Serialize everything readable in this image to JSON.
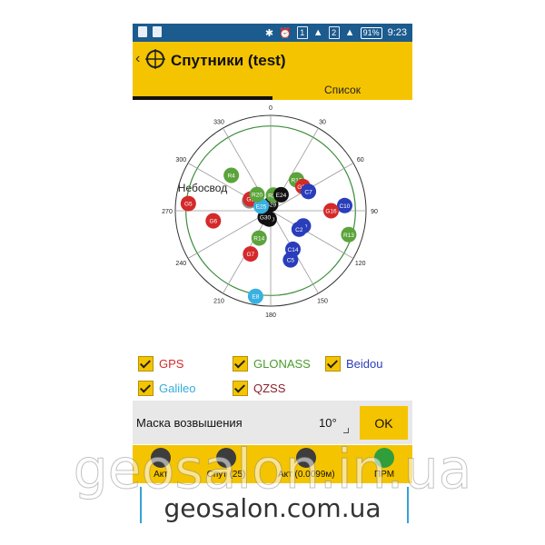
{
  "status_bar": {
    "battery": "91%",
    "time": "9:23",
    "sim1": "1",
    "sim2": "2"
  },
  "app_bar": {
    "title": "Спутники (test)"
  },
  "tabs": [
    {
      "label": "Небосвод",
      "active": true
    },
    {
      "label": "Список",
      "active": false
    }
  ],
  "sky_plot": {
    "azimuth_labels": [
      "0",
      "30",
      "60",
      "90",
      "120",
      "150",
      "180",
      "210",
      "240",
      "270",
      "300",
      "330"
    ],
    "elevation_mask_deg": 10,
    "satellites": [
      {
        "id": "G29",
        "system": "GPS",
        "az": 0,
        "el": 84
      },
      {
        "id": "R21",
        "system": "GLONASS",
        "az": 10,
        "el": 75
      },
      {
        "id": "E24",
        "system": "Galileo",
        "az": 33,
        "el": 72
      },
      {
        "id": "R12",
        "system": "GLONASS",
        "az": 40,
        "el": 52
      },
      {
        "id": "G26",
        "system": "GPS",
        "az": 53,
        "el": 52
      },
      {
        "id": "C7",
        "system": "Beidou",
        "az": 63,
        "el": 50
      },
      {
        "id": "C10",
        "system": "Beidou",
        "az": 86,
        "el": 20
      },
      {
        "id": "G16",
        "system": "GPS",
        "az": 90,
        "el": 33
      },
      {
        "id": "R13",
        "system": "GLONASS",
        "az": 107,
        "el": 13
      },
      {
        "id": "C9",
        "system": "Beidou",
        "az": 115,
        "el": 56
      },
      {
        "id": "C2",
        "system": "Beidou",
        "az": 123,
        "el": 58
      },
      {
        "id": "C14",
        "system": "Beidou",
        "az": 150,
        "el": 48
      },
      {
        "id": "C5",
        "system": "Beidou",
        "az": 158,
        "el": 40
      },
      {
        "id": "E30",
        "system": "Galileo",
        "az": 190,
        "el": 82
      },
      {
        "id": "R14",
        "system": "GLONASS",
        "az": 203,
        "el": 62
      },
      {
        "id": "G30",
        "system": "GPS",
        "az": 220,
        "el": 82
      },
      {
        "id": "G7",
        "system": "GPS",
        "az": 205,
        "el": 45
      },
      {
        "id": "G6",
        "system": "GPS",
        "az": 260,
        "el": 35
      },
      {
        "id": "E8",
        "system": "Galileo",
        "az": 190,
        "el": 8
      },
      {
        "id": "G5",
        "system": "GPS",
        "az": 275,
        "el": 12
      },
      {
        "id": "R4",
        "system": "GLONASS",
        "az": 312,
        "el": 40
      },
      {
        "id": "E7",
        "system": "Galileo",
        "az": 295,
        "el": 68
      },
      {
        "id": "G2",
        "system": "GPS",
        "az": 300,
        "el": 68
      },
      {
        "id": "E25",
        "system": "Galileo",
        "az": 296,
        "el": 80
      },
      {
        "id": "R20",
        "system": "GLONASS",
        "az": 320,
        "el": 70
      }
    ]
  },
  "filters": [
    {
      "label": "GPS",
      "checked": true
    },
    {
      "label": "GLONASS",
      "checked": true
    },
    {
      "label": "Beidou",
      "checked": true
    },
    {
      "label": "Galileo",
      "checked": true
    },
    {
      "label": "QZSS",
      "checked": true
    }
  ],
  "mask": {
    "label": "Маска возвышения",
    "value": "10°",
    "ok": "OK"
  },
  "bottom_bar": [
    {
      "label": "Акт",
      "icon": "crosshair-icon"
    },
    {
      "label": "Спут (25)",
      "icon": "satellite-icon"
    },
    {
      "label": "Акт (0.0099м)",
      "icon": "antenna-icon"
    },
    {
      "label": "ПРМ",
      "icon": "receiver-icon"
    }
  ],
  "footer": {
    "site": "geosalon.com.ua"
  },
  "watermark": {
    "text": "geosalon.in.ua"
  },
  "colors": {
    "GPS": "#d42a2a",
    "GLONASS": "#5ba33b",
    "Beidou": "#2a3dbb",
    "Galileo": "#38b1e0",
    "QZSS": "#8a1f2a",
    "accent": "#f5c400",
    "status_bar": "#1c5b8e"
  }
}
